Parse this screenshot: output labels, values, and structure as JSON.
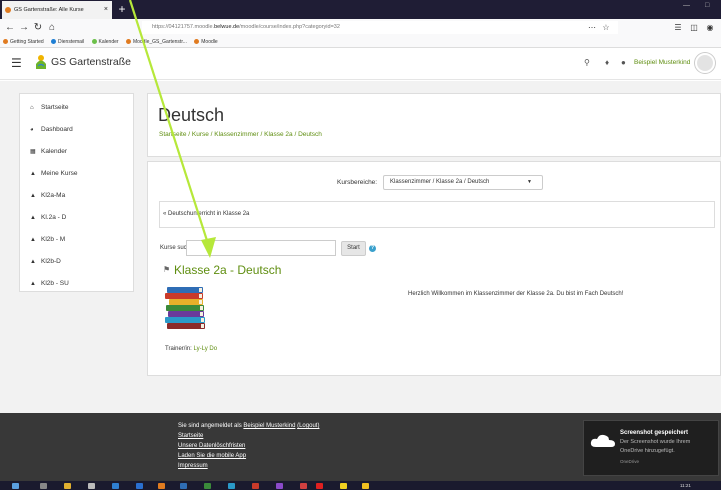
{
  "browser": {
    "tab_title": "GS Gartenstraße: Alle Kurse",
    "tab_close": "×",
    "new_tab": "+",
    "url_prefix": "https://04121757.moodle.",
    "url_domain": "belwue.de",
    "url_suffix": "/moodle/course/index.php?categoryid=32",
    "bookmarks": [
      "Getting Started",
      "Dienstemail",
      "Kalender",
      "Moodle_GS_Gartenstr...",
      "Moodle"
    ]
  },
  "header": {
    "site_name": "GS Gartenstraße",
    "user_name": "Beispiel Musterkind"
  },
  "sidebar": {
    "items": [
      {
        "label": "Startseite",
        "icon": "home-icon"
      },
      {
        "label": "Dashboard",
        "icon": "dashboard-icon"
      },
      {
        "label": "Kalender",
        "icon": "calendar-icon"
      },
      {
        "label": "Meine Kurse",
        "icon": "graduation-cap-icon"
      },
      {
        "label": "Kl2a-Ma",
        "icon": "graduation-cap-icon"
      },
      {
        "label": "Kl.2a - D",
        "icon": "graduation-cap-icon"
      },
      {
        "label": "Kl2b - M",
        "icon": "graduation-cap-icon"
      },
      {
        "label": "Kl2b-D",
        "icon": "graduation-cap-icon"
      },
      {
        "label": "Kl2b - SU",
        "icon": "graduation-cap-icon"
      }
    ]
  },
  "page": {
    "title": "Deutsch",
    "breadcrumb": "Startseite  /  Kurse  /  Klassenzimmer  /  Klasse 2a  /  Deutsch"
  },
  "main": {
    "kursbereiche_label": "Kursbereiche:",
    "kursbereiche_value": "Klassenzimmer / Klasse 2a / Deutsch",
    "category_description": "« Deutschunterricht in Klasse 2a",
    "search_label": "Kurse suchen",
    "search_button": "Start",
    "help": "?",
    "course_title": "Klasse 2a - Deutsch",
    "course_summary": "Herzlich Willkommen im Klassenzimmer der Klasse 2a. Du bist im Fach Deutsch!",
    "trainer_label": "Trainer/in:",
    "trainer_name": "Ly-Ly Do"
  },
  "footer": {
    "logged_in_prefix": "Sie sind angemeldet als",
    "logged_in_user": "Beispiel Musterkind",
    "logout": "(Logout)",
    "links": [
      "Startseite",
      "Unsere Datenlöschfristen",
      "Laden Sie die mobile App",
      "Impressum"
    ]
  },
  "toast": {
    "title": "Screenshot gespeichert",
    "line1": "Der Screenshot wurde Ihrem",
    "line2": "OneDrive hinzugefügt.",
    "app": "OneDrive"
  },
  "taskbar": {
    "clock": "11:21"
  },
  "colors": {
    "accent_green": "#5f8e10",
    "arrow": "#b6e83a",
    "footer_bg": "#383838"
  }
}
